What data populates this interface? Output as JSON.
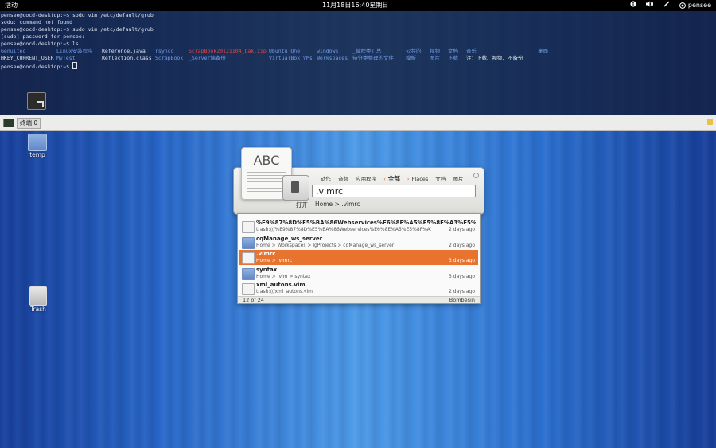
{
  "topbar": {
    "activities": "活动",
    "clock": "11月18日16:40星期日",
    "user": "pensee",
    "tray_icons": [
      "accessibility-icon",
      "volume-icon",
      "pen-icon",
      "user-icon"
    ]
  },
  "terminal": {
    "lines": [
      "pensee@cocd-desktop:~$ sodu vim /etc/default/grub",
      "sodu: command not found",
      "pensee@cocd-desktop:~$ sudo vim /etc/default/grub",
      "[sudo] password for pensee:",
      "pensee@cocd-desktop:~$ ls"
    ],
    "ls_row1": [
      {
        "text": "Genuitec",
        "color": "blue"
      },
      {
        "text": "Linux安装程序",
        "color": "blue"
      },
      {
        "text": "Reference.java",
        "color": "white"
      },
      {
        "text": "rsyncd",
        "color": "blue"
      },
      {
        "text": "ScrapBook20121104_bak.zip",
        "color": "red"
      },
      {
        "text": "Ubuntu One",
        "color": "blue"
      },
      {
        "text": "windows",
        "color": "blue"
      },
      {
        "text": "_编程类汇总",
        "color": "blue"
      },
      {
        "text": "公共的",
        "color": "blue"
      },
      {
        "text": "视频",
        "color": "blue"
      },
      {
        "text": "文档",
        "color": "blue"
      },
      {
        "text": "音乐",
        "color": "blue"
      },
      {
        "text": "桌面",
        "color": "blue"
      }
    ],
    "ls_row2": [
      {
        "text": "HKEY_CURRENT_USER",
        "color": "white"
      },
      {
        "text": "MyTest",
        "color": "blue"
      },
      {
        "text": "Reflection.class",
        "color": "white"
      },
      {
        "text": "ScrapBook",
        "color": "blue"
      },
      {
        "text": "_Server端备份",
        "color": "blue"
      },
      {
        "text": "VirtualBox VMs",
        "color": "blue"
      },
      {
        "text": "Workspaces",
        "color": "blue"
      },
      {
        "text": "待分类整理的文件",
        "color": "blue"
      },
      {
        "text": "模板",
        "color": "blue"
      },
      {
        "text": "图片",
        "color": "blue"
      },
      {
        "text": "下载",
        "color": "blue"
      },
      {
        "text": "注：下载、视频、不备份",
        "color": "white"
      }
    ],
    "prompt": "pensee@cocd-desktop:~$ "
  },
  "taskbar": {
    "window_label": "终端 0"
  },
  "desktop": {
    "icons": [
      {
        "label": "temp"
      },
      {
        "label": "Trash"
      }
    ]
  },
  "launcher": {
    "abc": "ABC",
    "action_label": "打开",
    "categories": [
      "动作",
      "音频",
      "应用程序"
    ],
    "current_category": "全部",
    "places": "Places",
    "categories_after": [
      "文档",
      "图片"
    ],
    "query": ".vimrc",
    "query_path": "Home > .vimrc"
  },
  "results": {
    "items": [
      {
        "title": "%E9%87%8D%E5%BA%86Webservices%E6%8E%A5%E5%8F%A3%E5%...",
        "sub": "trash:///%E9%87%8D%E5%BA%86Webservices%E6%8E%A5%E5%8F%A3%E5...",
        "date": "2 days ago",
        "kind": "file",
        "selected": false
      },
      {
        "title": "cqManage_ws_server",
        "sub": "Home > Workspaces > lgProjects > cqManage_ws_server",
        "date": "2 days ago",
        "kind": "folder",
        "selected": false
      },
      {
        "title": ".vimrc",
        "sub": "Home > .vimrc",
        "date": "3 days ago",
        "kind": "file",
        "selected": true
      },
      {
        "title": "syntax",
        "sub": "Home > .vim > syntax",
        "date": "3 days ago",
        "kind": "folder",
        "selected": false
      },
      {
        "title": "xml_autons.vim",
        "sub": "trash:///xml_autons.vim",
        "date": "2 days ago",
        "kind": "file",
        "selected": false
      }
    ],
    "count": "12 of 24",
    "plugin": "Bombesin"
  }
}
